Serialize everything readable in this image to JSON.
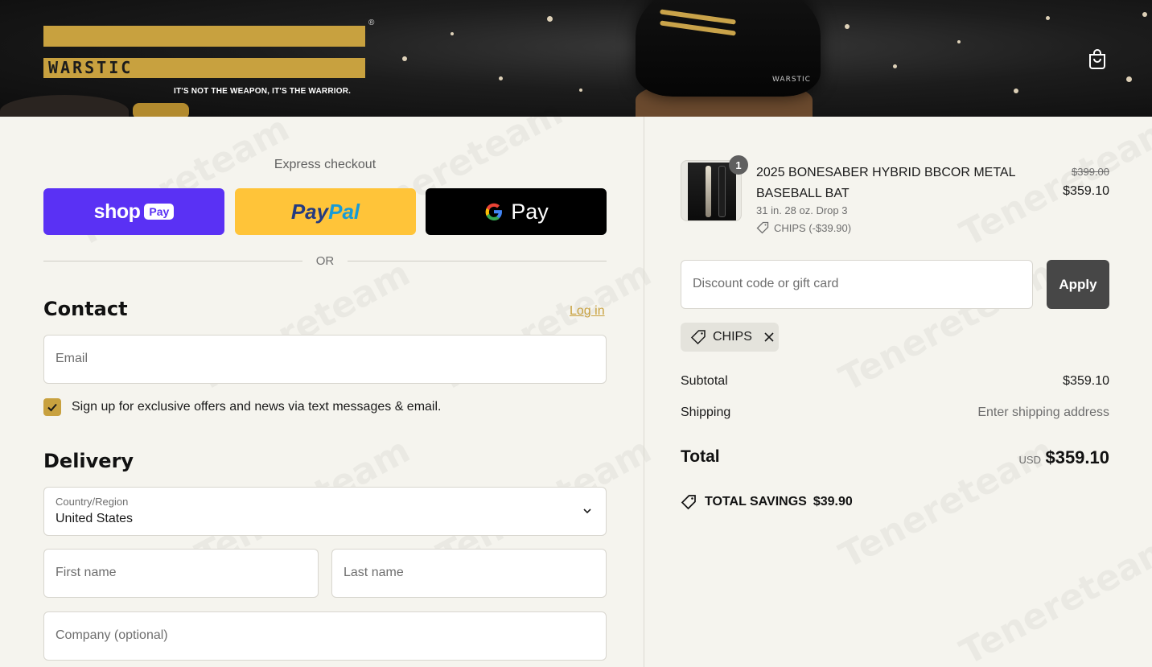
{
  "header": {
    "logo_text": "WARSTIC",
    "logo_reg": "®",
    "tagline": "IT'S NOT THE WEAPON, IT'S THE WARRIOR.",
    "hat_brand": "WARSTIC",
    "cart_icon": "shopping-bag-icon"
  },
  "express": {
    "title": "Express checkout",
    "shop_label": "shop",
    "shop_pay_label": "Pay",
    "paypal_part1": "Pay",
    "paypal_part2": "Pal",
    "gpay_label": "Pay",
    "or_label": "OR"
  },
  "contact": {
    "heading": "Contact",
    "login_label": "Log in",
    "email_placeholder": "Email",
    "signup_label": "Sign up for exclusive offers and news via text messages & email.",
    "signup_checked": true
  },
  "delivery": {
    "heading": "Delivery",
    "country_label": "Country/Region",
    "country_value": "United States",
    "first_name_placeholder": "First name",
    "last_name_placeholder": "Last name",
    "company_placeholder": "Company (optional)"
  },
  "order": {
    "item": {
      "quantity": "1",
      "name": "2025 BONESABER HYBRID BBCOR METAL BASEBALL BAT",
      "variant": "31 in. 28 oz. Drop 3",
      "discount": "CHIPS (-$39.90)",
      "original_price": "$399.00",
      "price": "$359.10"
    },
    "discount_placeholder": "Discount code or gift card",
    "apply_label": "Apply",
    "applied_code": "CHIPS",
    "subtotal_label": "Subtotal",
    "subtotal_value": "$359.10",
    "shipping_label": "Shipping",
    "shipping_value": "Enter shipping address",
    "total_label": "Total",
    "total_currency": "USD",
    "total_value": "$359.10",
    "savings_label": "TOTAL SAVINGS",
    "savings_value": "$39.90"
  },
  "colors": {
    "accent_gold": "#c8a13f",
    "shop_purple": "#5a31f4",
    "paypal_yellow": "#ffc439",
    "apply_button": "#474747",
    "page_bg": "#f5f4ee"
  }
}
